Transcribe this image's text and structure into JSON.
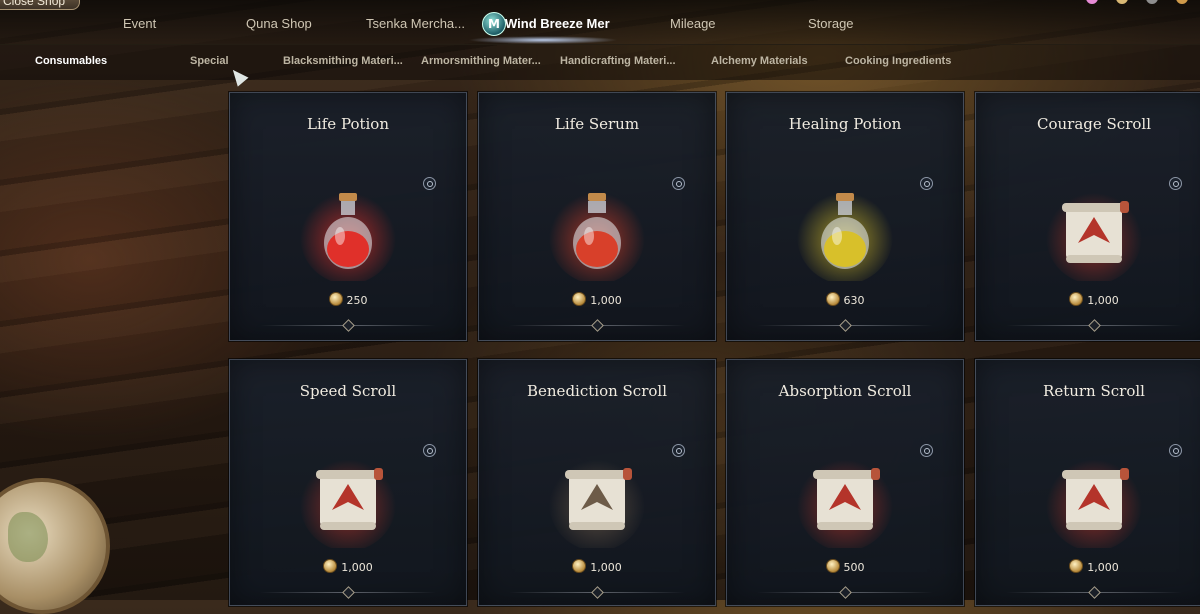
{
  "top_bar": {
    "close_label": "Close Shop",
    "tabs": [
      {
        "label": "Event"
      },
      {
        "label": "Quna Shop"
      },
      {
        "label": "Tsenka Mercha..."
      },
      {
        "label": "Wind Breeze Mer",
        "badge": "M"
      },
      {
        "label": "Mileage"
      },
      {
        "label": "Storage"
      }
    ],
    "active_tab_index": 3
  },
  "sub_tabs": [
    {
      "label": "Consumables"
    },
    {
      "label": "Special"
    },
    {
      "label": "Blacksmithing Materi..."
    },
    {
      "label": "Armorsmithing Mater..."
    },
    {
      "label": "Handicrafting Materi..."
    },
    {
      "label": "Alchemy Materials"
    },
    {
      "label": "Cooking Ingredients"
    }
  ],
  "active_sub_tab_index": 0,
  "items": [
    {
      "name": "Life Potion",
      "price": "250",
      "icon": "red-potion-flask",
      "color": "#e0302a"
    },
    {
      "name": "Life Serum",
      "price": "1,000",
      "icon": "red-serum-bottle",
      "color": "#d8402a"
    },
    {
      "name": "Healing Potion",
      "price": "630",
      "icon": "yellow-potion-flask",
      "color": "#d8c02a"
    },
    {
      "name": "Courage Scroll",
      "price": "1,000",
      "icon": "scroll-bird-emblem",
      "color": "#b4342a"
    },
    {
      "name": "Speed Scroll",
      "price": "1,000",
      "icon": "scroll-speed-emblem",
      "color": "#b4342a"
    },
    {
      "name": "Benediction Scroll",
      "price": "1,000",
      "icon": "scroll-star-emblem",
      "color": "#6d5b48"
    },
    {
      "name": "Absorption Scroll",
      "price": "500",
      "icon": "scroll-shield-emblem",
      "color": "#b4342a"
    },
    {
      "name": "Return Scroll",
      "price": "1,000",
      "icon": "scroll-return-emblem",
      "color": "#b4342a"
    }
  ]
}
